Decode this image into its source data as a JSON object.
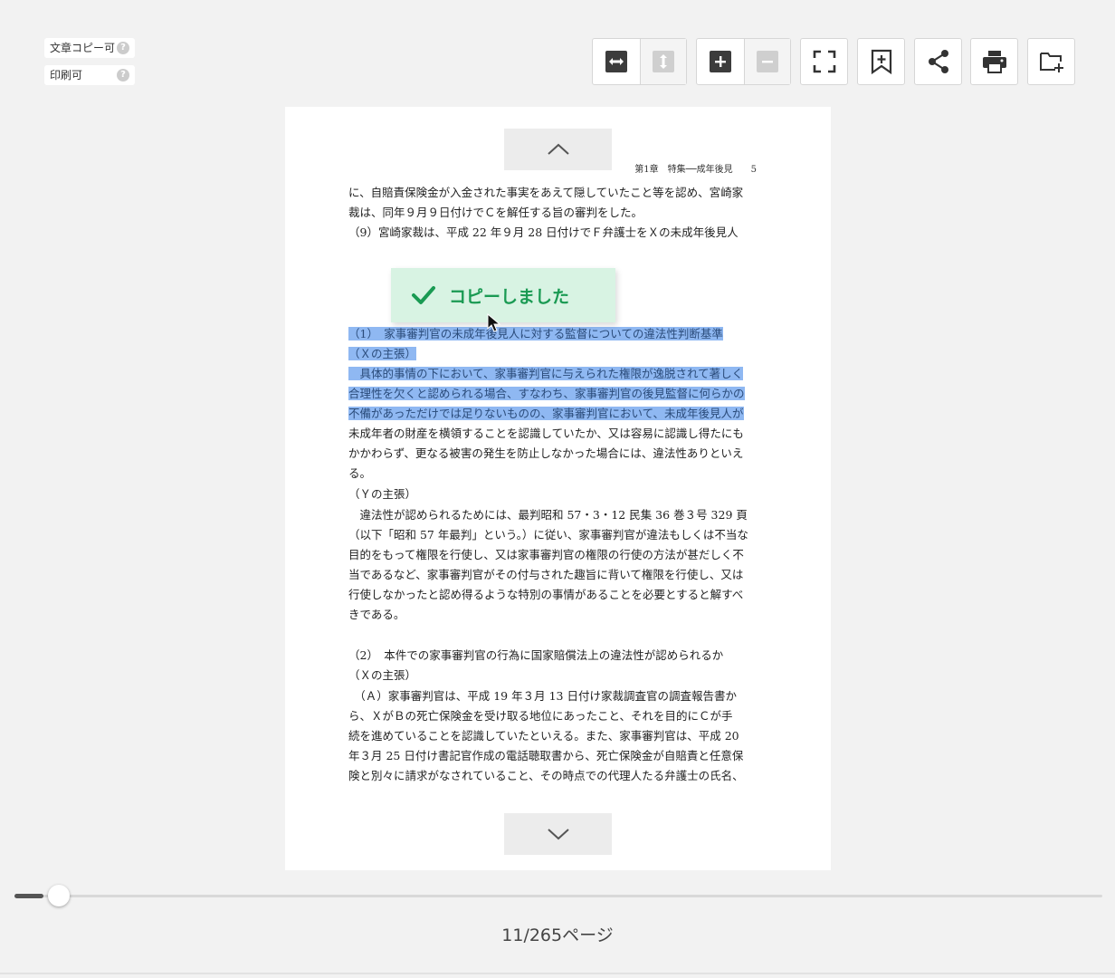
{
  "permissions": {
    "copy_label": "文章コピー可",
    "print_label": "印刷可",
    "help_glyph": "?"
  },
  "toolbar": {
    "icons": [
      "fit-width-icon",
      "fit-height-icon",
      "zoom-in-icon",
      "zoom-out-icon",
      "fullscreen-icon",
      "bookmark-add-icon",
      "share-icon",
      "print-icon",
      "add-to-folder-icon"
    ]
  },
  "document": {
    "running_header": "第1章　特集──成年後見　　5",
    "lines": [
      "に、自賠責保険金が入金された事実をあえて隠していたこと等を認め、宮崎家",
      "裁は、同年９月９日付けでＣを解任する旨の審判をした。",
      "（9）宮崎家裁は、平成 22 年９月 28 日付けでＦ弁護士をＸの未成年後見人",
      "（1）　家事審判官の未成年後見人に対する監督についての違法性判断基準",
      "（Ｘの主張）",
      "　具体的事情の下において、家事審判官に与えられた権限が逸脱されて著しく",
      "合理性を欠くと認められる場合、すなわち、家事審判官の後見監督に何らかの",
      "不備があっただけでは足りないものの、家事審判官において、未成年後見人が",
      "未成年者の財産を横領することを認識していたか、又は容易に認識し得たにも",
      "かかわらず、更なる被害の発生を防止しなかった場合には、違法性ありといえ",
      "る。",
      "（Ｙの主張）",
      "　違法性が認められるためには、最判昭和 57・3・12 民集 36 巻３号 329 頁",
      "（以下「昭和 57 年最判」という。）に従い、家事審判官が違法もしくは不当な",
      "目的をもって権限を行使し、又は家事審判官の権限の行使の方法が甚だしく不",
      "当であるなど、家事審判官がその付与された趣旨に背いて権限を行使し、又は",
      "行使しなかったと認め得るような特別の事情があることを必要とすると解すべ",
      "きである。",
      "（2）　本件での家事審判官の行為に国家賠償法上の違法性が認められるか",
      "（Ｘの主張）",
      "　（Ａ）家事審判官は、平成 19 年３月 13 日付け家裁調査官の調査報告書か",
      "ら、ＸがＢの死亡保険金を受け取る地位にあったこと、それを目的にＣが手",
      "続を進めていることを認識していたといえる。また、家事審判官は、平成 20",
      "年３月 25 日付け書記官作成の電話聴取書から、死亡保険金が自賠責と任意保",
      "険と別々に請求がなされていること、その時点での代理人たる弁護士の氏名、"
    ]
  },
  "toast": {
    "message": "コピーしました"
  },
  "pager": {
    "current": 11,
    "total": 265,
    "label": "11/265ページ"
  }
}
